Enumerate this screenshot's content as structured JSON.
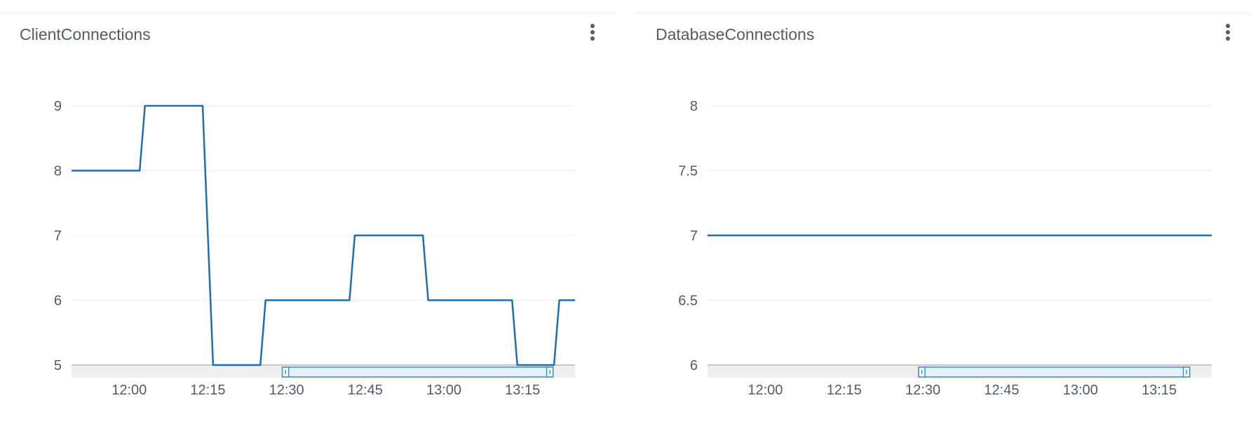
{
  "colors": {
    "line": "#1f6fad",
    "grid": "#eaeded",
    "text": "#545b64",
    "brush_fill": "#e6f2fa",
    "brush_stroke": "#3a8fd1",
    "overview_track": "#efefef"
  },
  "widgets": [
    {
      "title": "ClientConnections",
      "menu_icon": "vertical-ellipsis-icon",
      "chart_data": {
        "type": "line",
        "title": "ClientConnections",
        "xlabel": "",
        "ylabel": "",
        "ylim": [
          5,
          9
        ],
        "yticks": [
          "9",
          "8",
          "7",
          "6",
          "5"
        ],
        "xlim": [
          "11:49",
          "13:25"
        ],
        "xticks": [
          "12:00",
          "12:15",
          "12:30",
          "12:45",
          "13:00",
          "13:15"
        ],
        "grid": true,
        "legend": "none",
        "series": [
          {
            "x": [
              "11:49",
              "12:02",
              "12:03",
              "12:14",
              "12:16",
              "12:25",
              "12:26",
              "12:42",
              "12:43",
              "12:56",
              "12:57",
              "13:13",
              "13:14",
              "13:21",
              "13:22",
              "13:25"
            ],
            "y": [
              8,
              8,
              9,
              9,
              5,
              5,
              6,
              6,
              7,
              7,
              6,
              6,
              5,
              5,
              6,
              6
            ]
          }
        ],
        "time_range_brush": [
          "12:30",
          "13:20"
        ]
      }
    },
    {
      "title": "DatabaseConnections",
      "menu_icon": "vertical-ellipsis-icon",
      "chart_data": {
        "type": "line",
        "title": "DatabaseConnections",
        "xlabel": "",
        "ylabel": "",
        "ylim": [
          6,
          8
        ],
        "yticks": [
          "8",
          "7.5",
          "7",
          "6.5",
          "6"
        ],
        "xlim": [
          "11:49",
          "13:25"
        ],
        "xticks": [
          "12:00",
          "12:15",
          "12:30",
          "12:45",
          "13:00",
          "13:15"
        ],
        "grid": true,
        "legend": "none",
        "series": [
          {
            "x": [
              "11:49",
              "13:25"
            ],
            "y": [
              7,
              7
            ]
          }
        ],
        "time_range_brush": [
          "12:30",
          "13:20"
        ]
      }
    }
  ]
}
